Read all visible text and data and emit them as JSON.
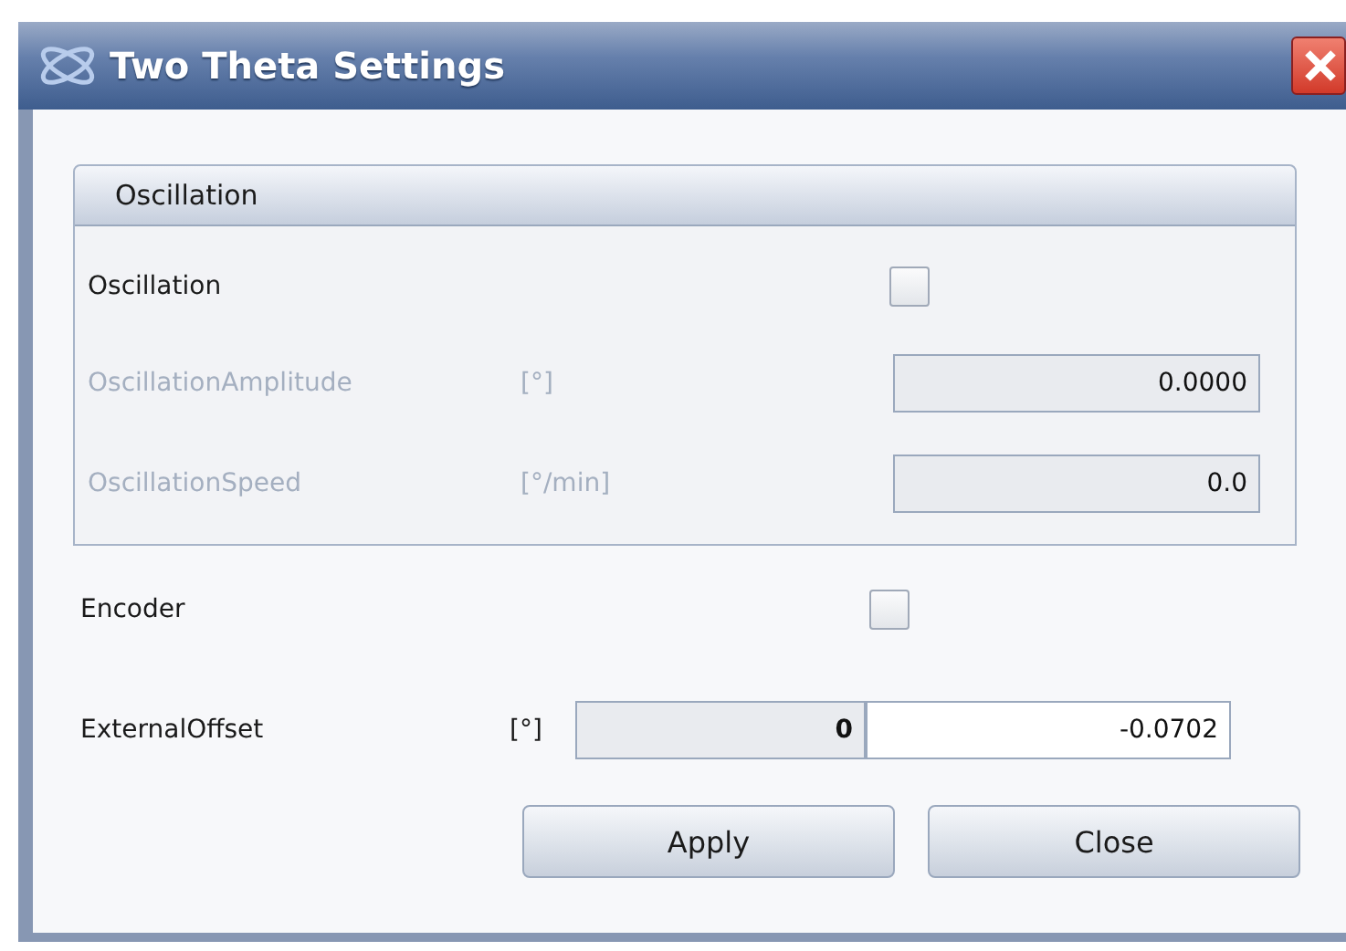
{
  "window": {
    "title": "Two Theta Settings"
  },
  "group": {
    "title": "Oscillation",
    "rows": [
      {
        "kind": "checkbox",
        "label": "Oscillation",
        "checked": false,
        "disabled": false
      },
      {
        "kind": "field",
        "label": "OscillationAmplitude",
        "unit": "[°]",
        "value": "0.0000",
        "disabled": true
      },
      {
        "kind": "field",
        "label": "OscillationSpeed",
        "unit": "[°/min]",
        "value": "0.0",
        "disabled": true
      }
    ]
  },
  "encoder": {
    "label": "Encoder",
    "checked": false
  },
  "external_offset": {
    "label": "ExternalOffset",
    "unit": "[°]",
    "readout": "0",
    "value": "-0.0702"
  },
  "buttons": [
    "Apply",
    "Close"
  ]
}
